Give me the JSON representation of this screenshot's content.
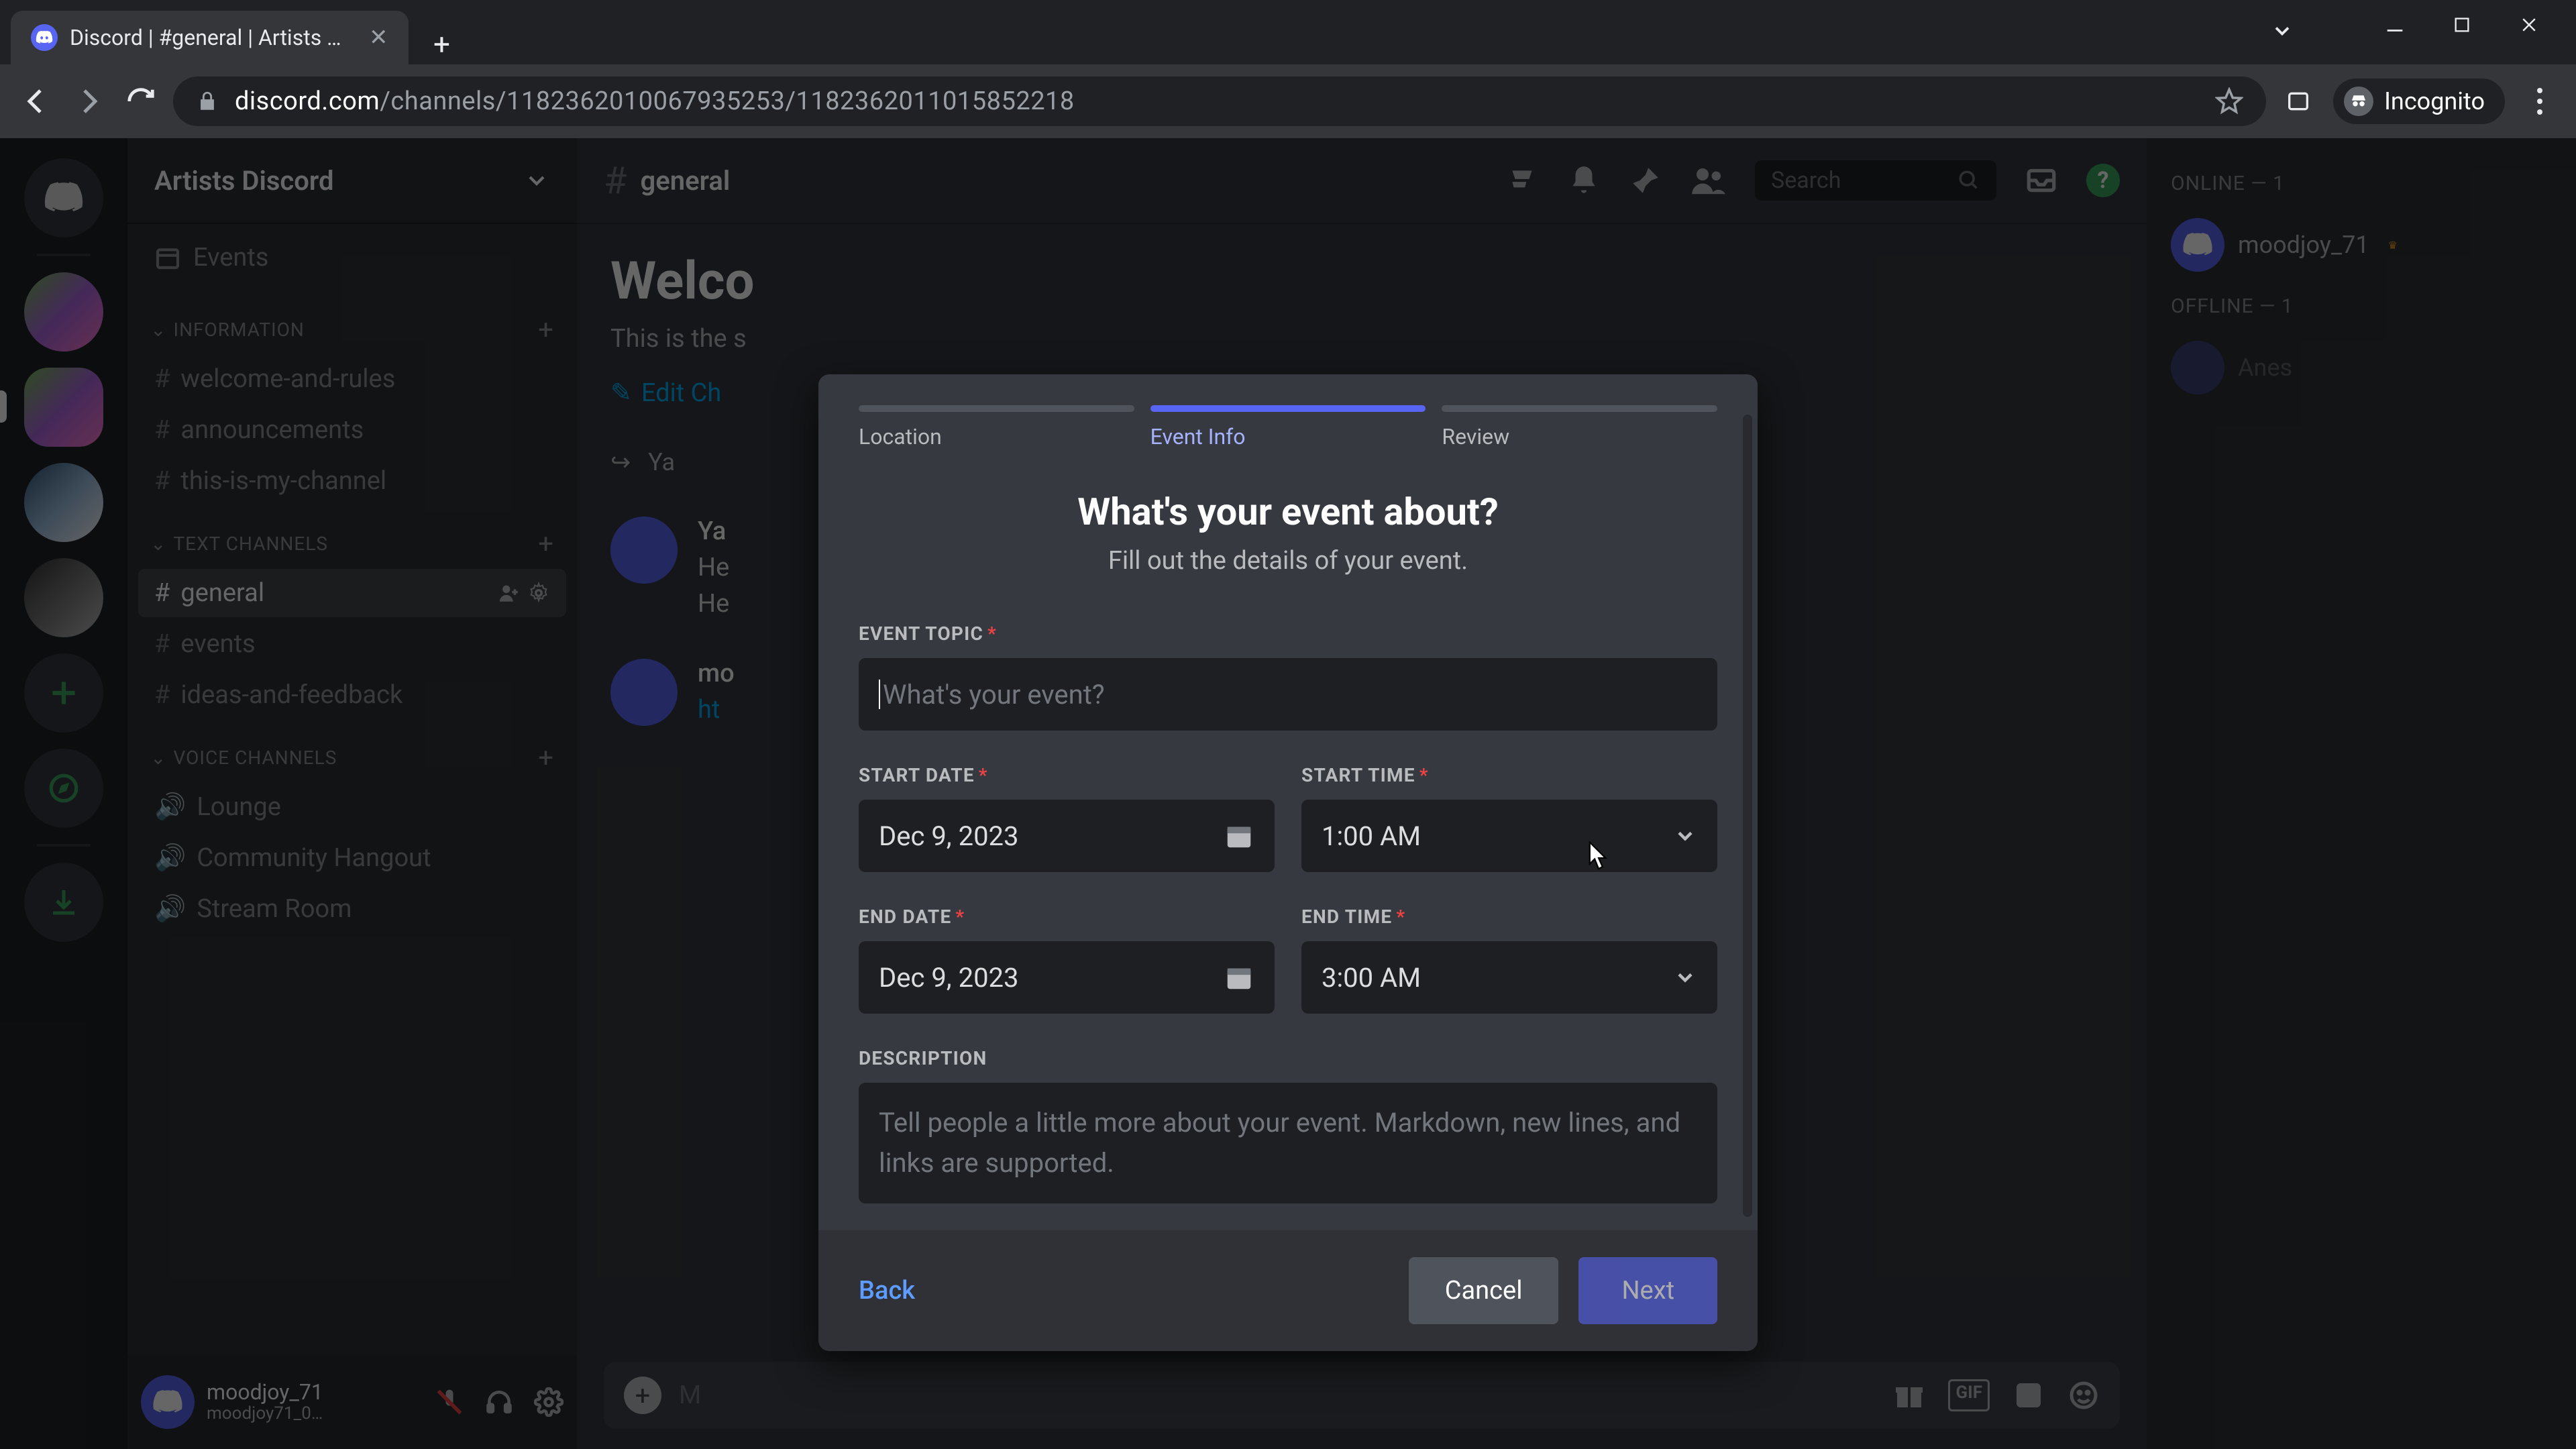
{
  "browser": {
    "tab_title": "Discord | #general | Artists Disc…",
    "url_domain": "discord.com",
    "url_path": "/channels/1182362010067935253/1182362011015852218",
    "incognito_label": "Incognito"
  },
  "server": {
    "name": "Artists Discord",
    "events_label": "Events"
  },
  "categories": {
    "information": {
      "name": "INFORMATION",
      "channels": [
        "welcome-and-rules",
        "announcements",
        "this-is-my-channel"
      ]
    },
    "text": {
      "name": "TEXT CHANNELS",
      "channels": [
        "general",
        "events",
        "ideas-and-feedback"
      ],
      "active": "general"
    },
    "voice": {
      "name": "VOICE CHANNELS",
      "channels": [
        "Lounge",
        "Community Hangout",
        "Stream Room"
      ]
    }
  },
  "user": {
    "name": "moodjoy_71",
    "sub": "moodjoy71_0…"
  },
  "chat": {
    "channel": "general",
    "welcome_title": "Welco",
    "welcome_sub": "This is the s",
    "edit_label": "Edit Ch",
    "msg1_author": "Ya",
    "msg1_line1": "He",
    "msg1_line2": "He",
    "msg2_author": "mo",
    "msg2_link": "ht",
    "input_placeholder": "M",
    "search_placeholder": "Search"
  },
  "members": {
    "online_header": "ONLINE — 1",
    "online": [
      {
        "name": "moodjoy_71",
        "owner": true
      }
    ],
    "offline_header": "OFFLINE — 1",
    "offline": [
      {
        "name": "Anes"
      }
    ]
  },
  "modal": {
    "steps": {
      "location": "Location",
      "event_info": "Event Info",
      "review": "Review"
    },
    "title": "What's your event about?",
    "subtitle": "Fill out the details of your event.",
    "labels": {
      "topic": "EVENT TOPIC",
      "start_date": "START DATE",
      "start_time": "START TIME",
      "end_date": "END DATE",
      "end_time": "END TIME",
      "description": "DESCRIPTION"
    },
    "topic_placeholder": "What's your event?",
    "start_date": "Dec 9, 2023",
    "start_time": "1:00 AM",
    "end_date": "Dec 9, 2023",
    "end_time": "3:00 AM",
    "description_placeholder": "Tell people a little more about your event. Markdown, new lines, and links are supported.",
    "buttons": {
      "back": "Back",
      "cancel": "Cancel",
      "next": "Next"
    }
  }
}
